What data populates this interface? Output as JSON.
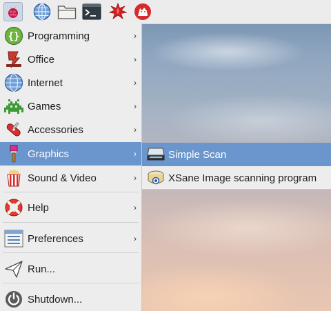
{
  "panel": {
    "launchers": [
      {
        "name": "raspberry-menu-icon"
      },
      {
        "name": "web-browser-icon"
      },
      {
        "name": "file-manager-icon"
      },
      {
        "name": "terminal-icon"
      },
      {
        "name": "mathematica-icon"
      },
      {
        "name": "wolfram-icon"
      }
    ]
  },
  "main_menu": {
    "items": [
      {
        "label": "Programming",
        "icon": "programming-icon",
        "has_submenu": true
      },
      {
        "label": "Office",
        "icon": "office-icon",
        "has_submenu": true
      },
      {
        "label": "Internet",
        "icon": "internet-icon",
        "has_submenu": true
      },
      {
        "label": "Games",
        "icon": "games-icon",
        "has_submenu": true
      },
      {
        "label": "Accessories",
        "icon": "accessories-icon",
        "has_submenu": true
      },
      {
        "label": "Graphics",
        "icon": "graphics-icon",
        "has_submenu": true,
        "highlighted": true
      },
      {
        "label": "Sound & Video",
        "icon": "sound-video-icon",
        "has_submenu": true
      },
      {
        "label": "Help",
        "icon": "help-icon",
        "has_submenu": true
      },
      {
        "label": "Preferences",
        "icon": "preferences-icon",
        "has_submenu": true
      },
      {
        "label": "Run...",
        "icon": "run-icon",
        "has_submenu": false
      },
      {
        "label": "Shutdown...",
        "icon": "shutdown-icon",
        "has_submenu": false
      }
    ],
    "arrow": "›"
  },
  "submenu": {
    "items": [
      {
        "label": "Simple Scan",
        "icon": "scanner-icon",
        "highlighted": true
      },
      {
        "label": "XSane Image scanning program",
        "icon": "xsane-icon"
      }
    ]
  },
  "colors": {
    "highlight": "#6a96cd",
    "menu_bg": "#ededed",
    "panel_bg": "#ececec"
  }
}
